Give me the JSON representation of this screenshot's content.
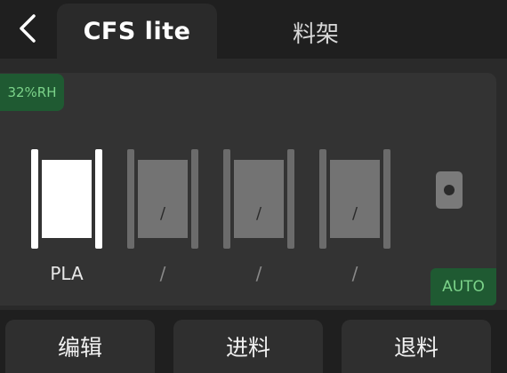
{
  "header": {
    "back_icon": "chevron-left-icon",
    "tabs": [
      {
        "label": "CFS lite",
        "active": true
      },
      {
        "label": "料架",
        "active": false
      }
    ]
  },
  "status": {
    "humidity": "32%RH",
    "mode": "AUTO",
    "accent_color": "#7cd38a",
    "badge_bg": "#1f5a32"
  },
  "slots": [
    {
      "name": "PLA",
      "spool_label": "",
      "state": "filled"
    },
    {
      "name": "/",
      "spool_label": "/",
      "state": "empty"
    },
    {
      "name": "/",
      "spool_label": "/",
      "state": "empty"
    },
    {
      "name": "/",
      "spool_label": "/",
      "state": "empty"
    }
  ],
  "actions": {
    "edit": "编辑",
    "load": "进料",
    "unload": "退料"
  }
}
